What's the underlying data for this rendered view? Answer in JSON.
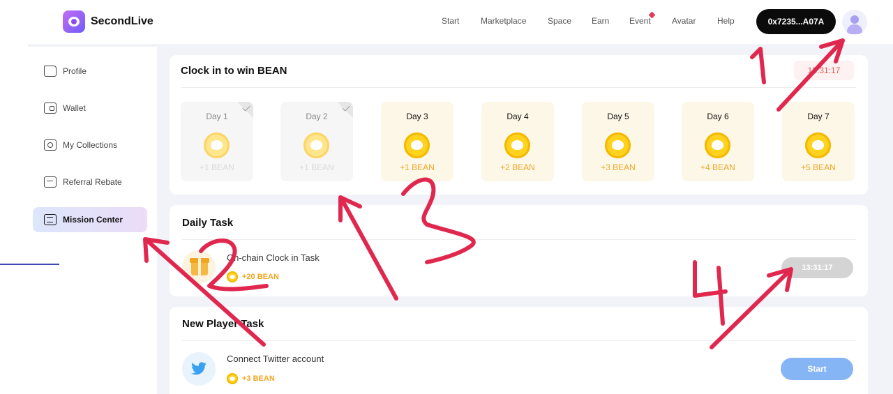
{
  "header": {
    "brand": "SecondLive",
    "nav": [
      {
        "label": "Start"
      },
      {
        "label": "Marketplace"
      },
      {
        "label": "Space"
      },
      {
        "label": "Earn"
      },
      {
        "label": "Event"
      },
      {
        "label": "Avatar"
      },
      {
        "label": "Help"
      }
    ],
    "wallet_address": "0x7235...A07A"
  },
  "sidebar": {
    "items": [
      {
        "label": "Profile",
        "icon": "folder-icon"
      },
      {
        "label": "Wallet",
        "icon": "wallet-icon"
      },
      {
        "label": "My Collections",
        "icon": "collections-icon"
      },
      {
        "label": "Referral Rebate",
        "icon": "referral-icon"
      },
      {
        "label": "Mission Center",
        "icon": "mission-icon",
        "active": true
      }
    ]
  },
  "clock_in": {
    "title": "Clock in to win BEAN",
    "countdown": "13:31:17",
    "days": [
      {
        "label": "Day 1",
        "reward": "+1 BEAN",
        "claimed": true
      },
      {
        "label": "Day 2",
        "reward": "+1 BEAN",
        "claimed": true
      },
      {
        "label": "Day 3",
        "reward": "+1 BEAN",
        "claimed": false
      },
      {
        "label": "Day 4",
        "reward": "+2 BEAN",
        "claimed": false
      },
      {
        "label": "Day 5",
        "reward": "+3 BEAN",
        "claimed": false
      },
      {
        "label": "Day 6",
        "reward": "+4 BEAN",
        "claimed": false
      },
      {
        "label": "Day 7",
        "reward": "+5 BEAN",
        "claimed": false
      }
    ]
  },
  "daily_task": {
    "title": "Daily Task",
    "task": {
      "title": "On-chain Clock in Task",
      "reward": "+20 BEAN",
      "button": "13:31:17"
    }
  },
  "new_player_task": {
    "title": "New Player Task",
    "task": {
      "title": "Connect Twitter account",
      "reward": "+3 BEAN",
      "button": "Start"
    }
  },
  "annotations": {
    "color": "#e0284f",
    "marks": [
      "1",
      "2",
      "3",
      "4"
    ]
  }
}
